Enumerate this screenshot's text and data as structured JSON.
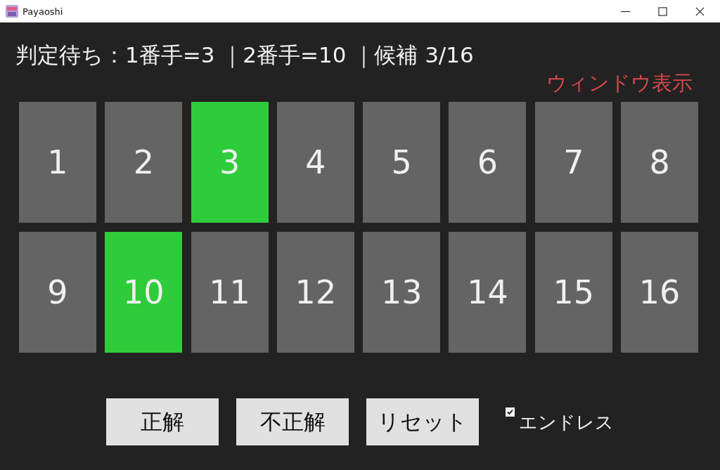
{
  "window": {
    "title": "Payaoshi"
  },
  "status_line": "判定待ち：1番手=3 ｜2番手=10 ｜候補 3/16",
  "window_link": "ウィンドウ表示",
  "cells": [
    {
      "label": "1",
      "selected": false
    },
    {
      "label": "2",
      "selected": false
    },
    {
      "label": "3",
      "selected": true
    },
    {
      "label": "4",
      "selected": false
    },
    {
      "label": "5",
      "selected": false
    },
    {
      "label": "6",
      "selected": false
    },
    {
      "label": "7",
      "selected": false
    },
    {
      "label": "8",
      "selected": false
    },
    {
      "label": "9",
      "selected": false
    },
    {
      "label": "10",
      "selected": true
    },
    {
      "label": "11",
      "selected": false
    },
    {
      "label": "12",
      "selected": false
    },
    {
      "label": "13",
      "selected": false
    },
    {
      "label": "14",
      "selected": false
    },
    {
      "label": "15",
      "selected": false
    },
    {
      "label": "16",
      "selected": false
    }
  ],
  "buttons": [
    "正解",
    "不正解",
    "リセット"
  ],
  "endless": {
    "label": "エンドレス",
    "checked": true
  }
}
